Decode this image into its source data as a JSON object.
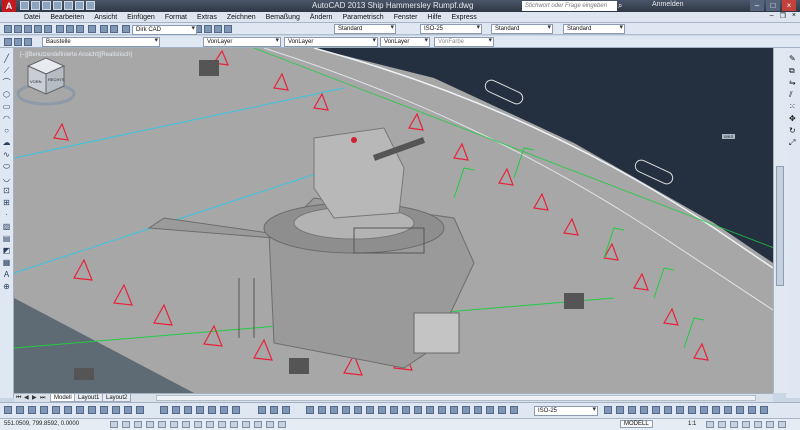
{
  "app": {
    "logo_letter": "A",
    "title": "AutoCAD 2013   Ship Hammersley Rumpf.dwg",
    "search_placeholder": "Stichwort oder Frage eingeben",
    "login_label": "Anmelden"
  },
  "menu": {
    "items": [
      "Datei",
      "Bearbeiten",
      "Ansicht",
      "Einfügen",
      "Format",
      "Extras",
      "Zeichnen",
      "Bemaßung",
      "Ändern",
      "Parametrisch",
      "Fenster",
      "Hilfe",
      "Express"
    ]
  },
  "toolbar": {
    "textstyle": "Standard",
    "dimstyle": "ISO-25",
    "tablestyle": "Standard",
    "mleaderstyle": "Standard",
    "workspace": "Dirk CAD",
    "layer": "Baustelle",
    "color": "VonLayer",
    "linetype": "VonLayer",
    "lineweight": "VonLayer",
    "plotstyle": "VonFarbe"
  },
  "viewport": {
    "label": "[–][Benutzerdefinierte Ansicht][Realistisch]",
    "viewcube": {
      "face_front": "VORN",
      "face_right": "RECHTS",
      "wcs_label": "WKS"
    }
  },
  "tabs": [
    "Modell",
    "Layout1",
    "Layout2"
  ],
  "bottom_toolbar": {
    "dimstyle": "ISO-25"
  },
  "status": {
    "coords": "551.0509, 799.8592, 0.0000",
    "mode": "MODELL",
    "scale": "1:1"
  },
  "colors": {
    "background": "#243040",
    "deck": "#a9a9a9",
    "frame_red": "#e8223a",
    "frame_green": "#22cc44",
    "frame_cyan": "#37c6e0"
  }
}
